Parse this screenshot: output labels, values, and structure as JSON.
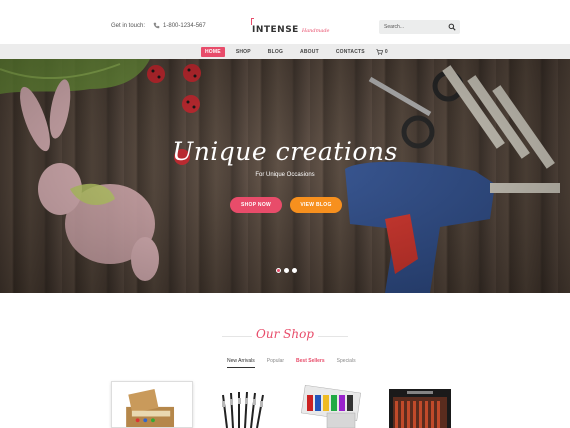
{
  "header": {
    "contact_label": "Get in touch:",
    "phone": "1-800-1234-567",
    "logo_main": "INTENSE",
    "logo_sub": "Handmade",
    "search_placeholder": "Search..."
  },
  "nav": {
    "items": [
      {
        "label": "HOME",
        "active": true
      },
      {
        "label": "SHOP"
      },
      {
        "label": "BLOG"
      },
      {
        "label": "ABOUT"
      },
      {
        "label": "CONTACTS"
      }
    ],
    "cart_count": "0"
  },
  "hero": {
    "title": "Unique creations",
    "subtitle": "For Unique Occasions",
    "primary_button": "SHOP NOW",
    "secondary_button": "VIEW BLOG",
    "slides": 3,
    "active_slide": 1
  },
  "shop": {
    "title": "Our Shop",
    "tabs": [
      {
        "label": "New Arrivals",
        "active": true
      },
      {
        "label": "Popular"
      },
      {
        "label": "Best Sellers",
        "highlight": true
      },
      {
        "label": "Specials"
      }
    ]
  },
  "colors": {
    "accent": "#e84c6a",
    "orange": "#f7901e",
    "nav_bg": "#ececec"
  }
}
